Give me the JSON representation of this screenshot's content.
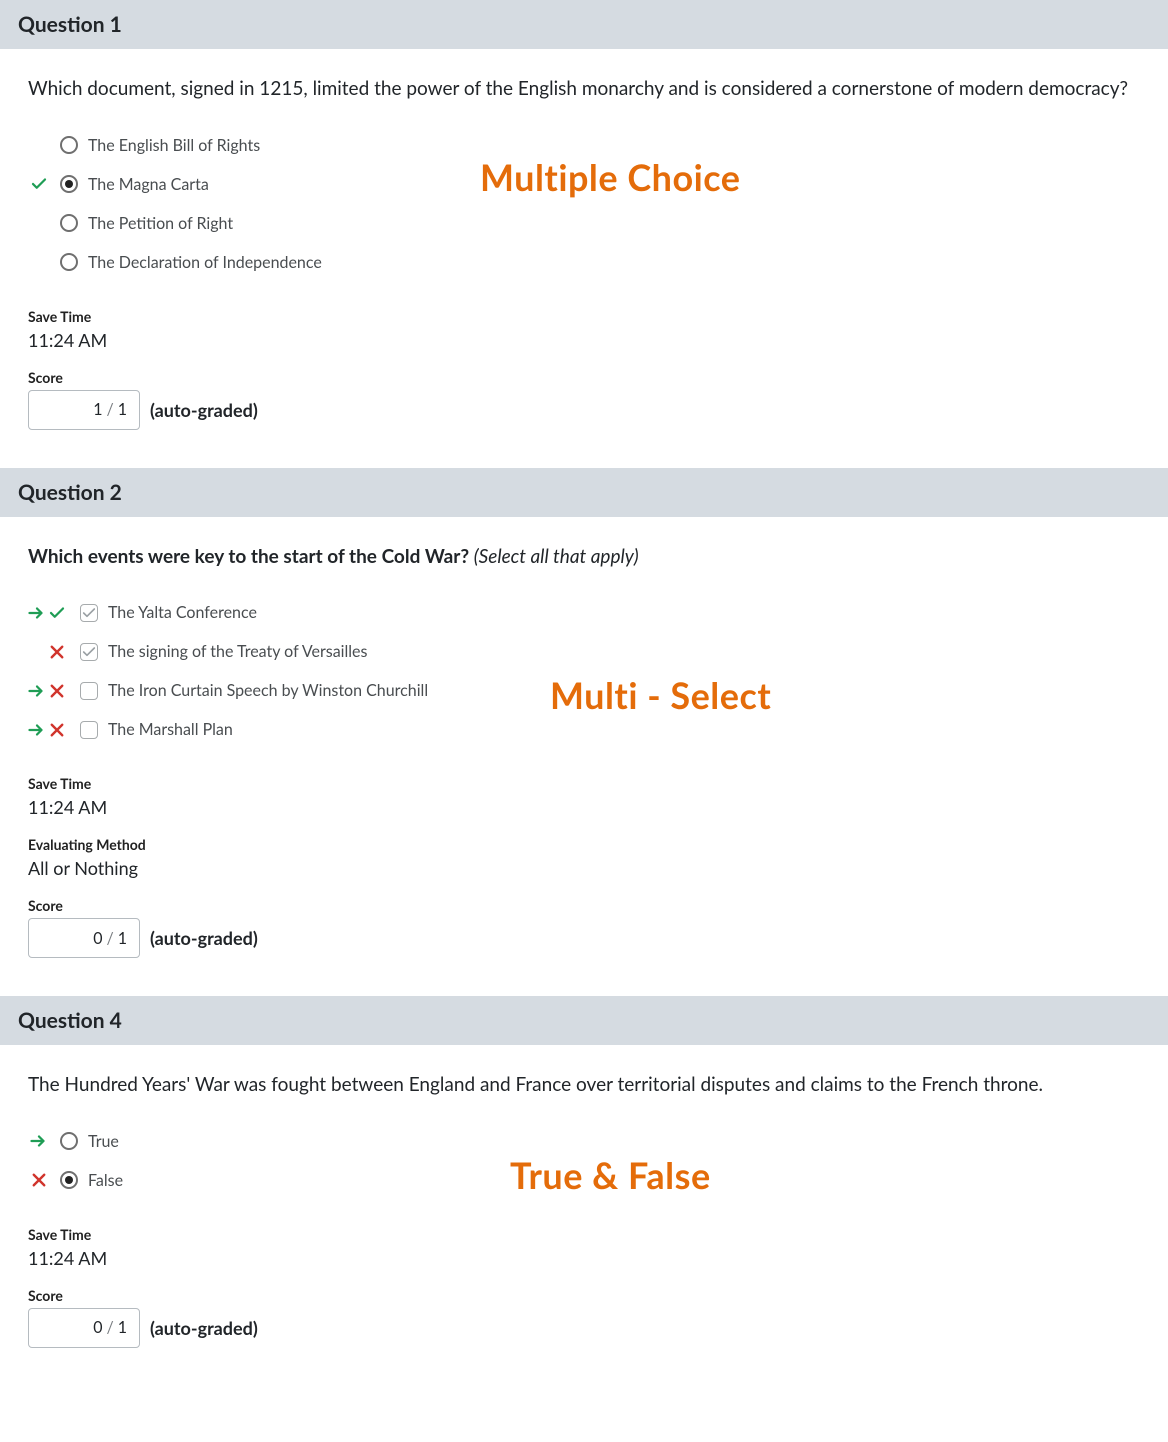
{
  "annotations": {
    "q1": "Multiple Choice",
    "q2": "Multi - Select",
    "q4": "True & False"
  },
  "labels": {
    "save_time": "Save Time",
    "score": "Score",
    "autograded": "(auto-graded)",
    "eval_method": "Evaluating Method"
  },
  "q1": {
    "header": "Question 1",
    "prompt": "Which document, signed in 1215, limited the power of the English monarchy and is considered a cornerstone of modern democracy?",
    "options": [
      {
        "label": "The English Bill of Rights",
        "selected": false,
        "correct": false
      },
      {
        "label": "The Magna Carta",
        "selected": true,
        "correct": true
      },
      {
        "label": "The Petition of Right",
        "selected": false,
        "correct": false
      },
      {
        "label": "The Declaration of Independence",
        "selected": false,
        "correct": false
      }
    ],
    "save_time": "11:24 AM",
    "score_got": "1",
    "score_max": "1"
  },
  "q2": {
    "header": "Question 2",
    "prompt": "Which events were key to the start of the Cold War? ",
    "prompt_hint": "(Select all that apply)",
    "options": [
      {
        "label": "The Yalta Conference",
        "checked": true,
        "arrow": true,
        "result": "correct"
      },
      {
        "label": "The signing of the Treaty of Versailles",
        "checked": true,
        "arrow": false,
        "result": "wrong"
      },
      {
        "label": "The Iron Curtain Speech by Winston Churchill",
        "checked": false,
        "arrow": true,
        "result": "wrong"
      },
      {
        "label": "The Marshall Plan",
        "checked": false,
        "arrow": true,
        "result": "wrong"
      }
    ],
    "save_time": "11:24 AM",
    "eval_method": "All or Nothing",
    "score_got": "0",
    "score_max": "1"
  },
  "q4": {
    "header": "Question 4",
    "prompt": "The Hundred Years' War was fought between England and France over territorial disputes and claims to the French throne.",
    "options": [
      {
        "label": "True",
        "selected": false,
        "arrow": true,
        "result": "none"
      },
      {
        "label": "False",
        "selected": true,
        "arrow": false,
        "result": "wrong"
      }
    ],
    "save_time": "11:24 AM",
    "score_got": "0",
    "score_max": "1"
  }
}
